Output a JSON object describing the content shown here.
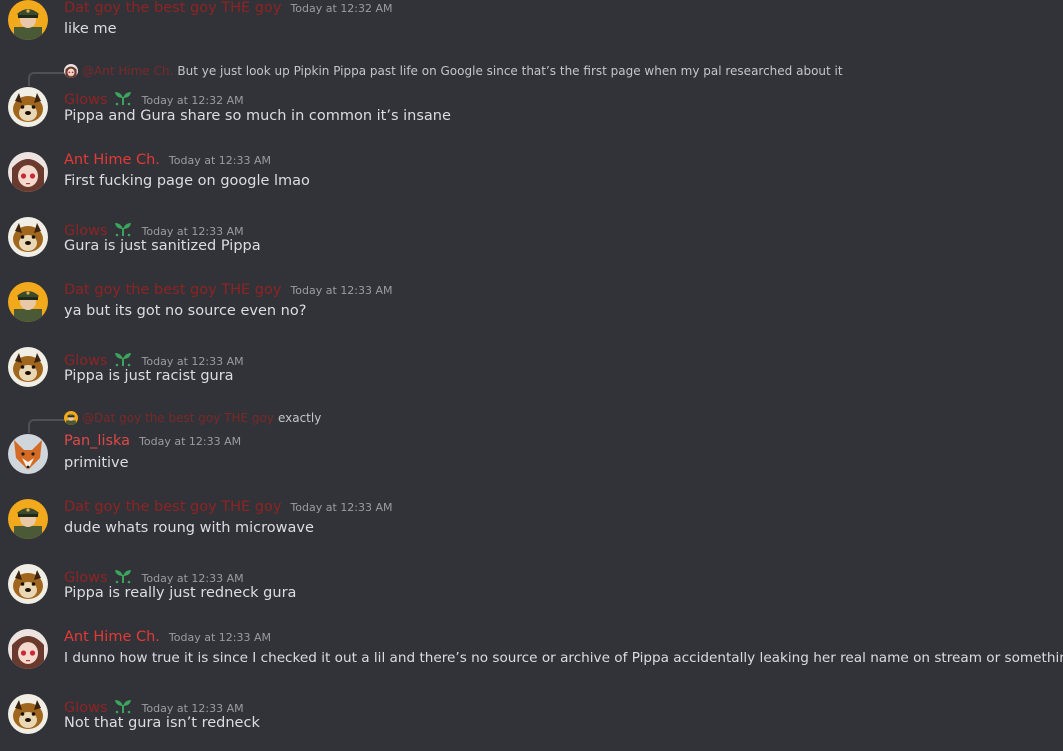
{
  "colors": {
    "dat": "#8f2323",
    "glows": "#8f2424",
    "ant": "#e53935",
    "pan": "#e04848",
    "badge_green": "#3ba55c",
    "text": "#dbdee1",
    "muted": "#9b9ca3"
  },
  "messages": [
    {
      "username": "Dat goy the best goy THE goy",
      "timestamp": "Today at 12:32 AM",
      "content": "like me"
    },
    {
      "username": "Glows",
      "timestamp": "Today at 12:32 AM",
      "content": "Pippa and Gura share so much in common it’s insane",
      "reply": {
        "mention": "@Ant Hime Ch.",
        "text": "But ye just look up Pipkin Pippa past life on Google since that’s the first page when my pal researched about it"
      }
    },
    {
      "username": "Ant Hime Ch.",
      "timestamp": "Today at 12:33 AM",
      "content": "First fucking page on google lmao"
    },
    {
      "username": "Glows",
      "timestamp": "Today at 12:33 AM",
      "content": "Gura is just sanitized Pippa"
    },
    {
      "username": "Dat goy the best goy THE goy",
      "timestamp": "Today at 12:33 AM",
      "content": "ya but its got no source even no?"
    },
    {
      "username": "Glows",
      "timestamp": "Today at 12:33 AM",
      "content": "Pippa is just racist gura"
    },
    {
      "username": "Pan_liska",
      "timestamp": "Today at 12:33 AM",
      "content": "primitive",
      "reply": {
        "mention": "@Dat goy the best goy THE goy",
        "text": "exactly"
      }
    },
    {
      "username": "Dat goy the best goy THE goy",
      "timestamp": "Today at 12:33 AM",
      "content": "dude whats roung with microwave"
    },
    {
      "username": "Glows",
      "timestamp": "Today at 12:33 AM",
      "content": "Pippa is really just redneck gura"
    },
    {
      "username": "Ant Hime Ch.",
      "timestamp": "Today at 12:33 AM",
      "content": "I dunno how true it is since I checked it out a lil and there’s no source or archive of Pippa accidentally leaking her real name on stream or something"
    },
    {
      "username": "Glows",
      "timestamp": "Today at 12:33 AM",
      "content": "Not that gura isn’t redneck"
    }
  ]
}
